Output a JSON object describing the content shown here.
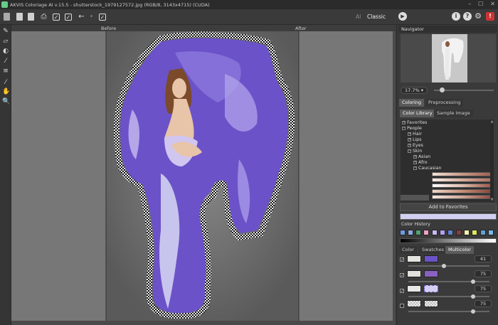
{
  "app": {
    "title": "AKVIS Coloriage AI v.15.5 - shutterstock_1979127572.jpg (RGB/8, 3143x4715) (CUDA)"
  },
  "toolbar": {
    "mode_ai": "AI",
    "mode_classic": "Classic"
  },
  "canvas": {
    "before_label": "Before",
    "after_label": "After"
  },
  "navigator": {
    "title": "Navigator",
    "zoom": "17.7%"
  },
  "tabs": {
    "coloring": "Coloring",
    "preprocessing": "Preprocessing"
  },
  "subtabs": {
    "library": "Color Library",
    "sample": "Sample Image"
  },
  "tree": {
    "favorites": "Favorites",
    "people": "People",
    "hair": "Hair",
    "lips": "Lips",
    "eyes": "Eyes",
    "skin": "Skin",
    "asian": "Asian",
    "afro": "Afro",
    "caucasian": "Caucasian"
  },
  "add_favorites": "Add to Favorites",
  "color_history": {
    "title": "Color History"
  },
  "bottom_tabs": {
    "color": "Color",
    "swatches": "Swatches",
    "multicolor": "Multicolor"
  },
  "multicolor": {
    "values": [
      "41",
      "75",
      "75",
      "75"
    ]
  },
  "colors": {
    "selected": "#d2d0f2",
    "violet": "#6c52c8",
    "history": [
      "#6f9be0",
      "#8fa8e0",
      "#55a070",
      "#f0a0c8",
      "#c8b8f0",
      "#b0a0f0",
      "#6080d0",
      "#804040",
      "#f0f0b0",
      "#e0e860",
      "#60a0d0",
      "#7ab8e8"
    ]
  }
}
